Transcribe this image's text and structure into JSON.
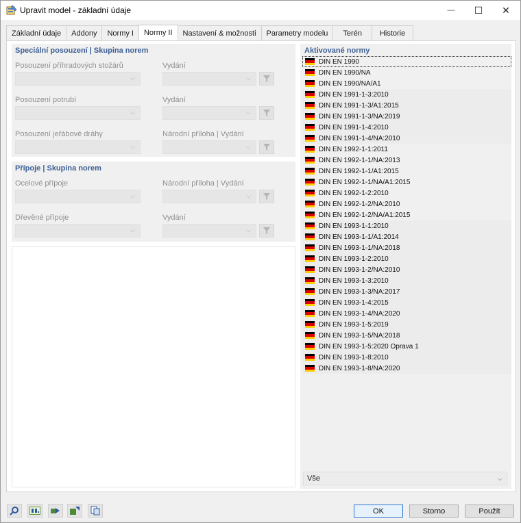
{
  "window": {
    "title": "Upravit model - základní údaje",
    "minimize_label": "—",
    "maximize_label": "☐",
    "close_label": "✕"
  },
  "tabs": [
    {
      "label": "Základní údaje"
    },
    {
      "label": "Addony"
    },
    {
      "label": "Normy I"
    },
    {
      "label": "Normy II"
    },
    {
      "label": "Nastavení & možnosti"
    },
    {
      "label": "Parametry modelu"
    },
    {
      "label": "Terén"
    },
    {
      "label": "Historie"
    }
  ],
  "active_tab": "Normy II",
  "special": {
    "title": "Speciální posouzení | Skupina norem",
    "fields": [
      {
        "label": "Posouzení příhradových stožárů",
        "edition_label": "Vydání"
      },
      {
        "label": "Posouzení potrubí",
        "edition_label": "Vydání"
      },
      {
        "label": "Posouzení jeřábové dráhy",
        "edition_label": "Národní příloha | Vydání"
      }
    ]
  },
  "connections": {
    "title": "Přípoje | Skupina norem",
    "fields": [
      {
        "label": "Ocelové přípoje",
        "edition_label": "Národní příloha | Vydání"
      },
      {
        "label": "Dřevěné přípoje",
        "edition_label": "Vydání"
      }
    ]
  },
  "activated": {
    "title": "Aktivované normy",
    "items": [
      "DIN EN 1990",
      "DIN EN 1990/NA",
      "DIN EN 1990/NA/A1",
      "DIN EN 1991-1-3:2010",
      "DIN EN 1991-1-3/A1:2015",
      "DIN EN 1991-1-3/NA:2019",
      "DIN EN 1991-1-4:2010",
      "DIN EN 1991-1-4/NA:2010",
      "DIN EN 1992-1-1:2011",
      "DIN EN 1992-1-1/NA:2013",
      "DIN EN 1992-1-1/A1:2015",
      "DIN EN 1992-1-1/NA/A1:2015",
      "DIN EN 1992-1-2:2010",
      "DIN EN 1992-1-2/NA:2010",
      "DIN EN 1992-1-2/NA/A1:2015",
      "DIN EN 1993-1-1:2010",
      "DIN EN 1993-1-1/A1:2014",
      "DIN EN 1993-1-1/NA:2018",
      "DIN EN 1993-1-2:2010",
      "DIN EN 1993-1-2/NA:2010",
      "DIN EN 1993-1-3:2010",
      "DIN EN 1993-1-3/NA:2017",
      "DIN EN 1993-1-4:2015",
      "DIN EN 1993-1-4/NA:2020",
      "DIN EN 1993-1-5:2019",
      "DIN EN 1993-1-5/NA:2018",
      "DIN EN 1993-1-5:2020 Oprava 1",
      "DIN EN 1993-1-8:2010",
      "DIN EN 1993-1-8/NA:2020"
    ],
    "shaded_groups": [
      [
        3,
        7
      ],
      [
        15,
        28
      ]
    ],
    "selected_index": 0,
    "filter_value": "Vše"
  },
  "buttons": {
    "ok": "OK",
    "cancel": "Storno",
    "apply": "Použít"
  },
  "colors": {
    "accent": "#3d5f95",
    "flag_black": "#000000",
    "flag_red": "#dd0000",
    "flag_gold": "#ffce00"
  }
}
